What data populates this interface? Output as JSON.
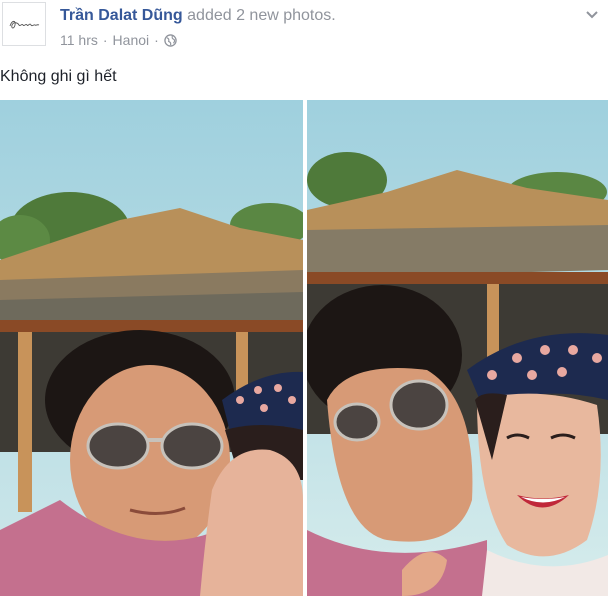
{
  "post": {
    "author": "Trần Dalat Dũng",
    "action": "added 2 new photos.",
    "time": "11 hrs",
    "separator": "·",
    "location": "Hanoi",
    "privacy_icon": "globe-icon",
    "menu_icon": "chevron-down-icon",
    "caption": "Không ghi gì hết",
    "avatar_icon": "signature-logo",
    "photo_count": 2
  },
  "colors": {
    "author_link": "#365899",
    "meta_text": "#90949c",
    "caption_text": "#1d2129"
  }
}
